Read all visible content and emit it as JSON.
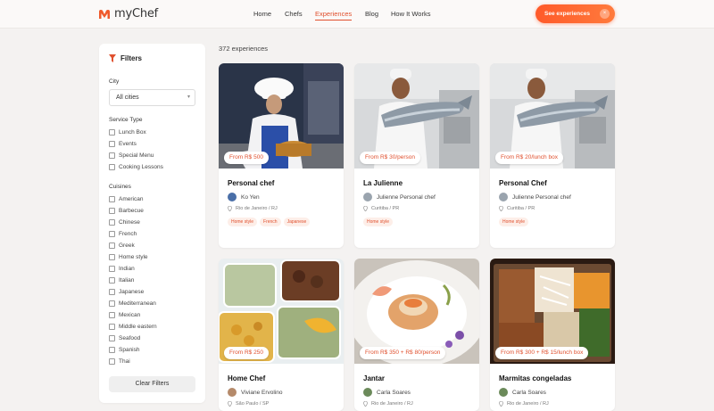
{
  "header": {
    "brand": "myChef",
    "nav": [
      {
        "label": "Home",
        "active": false
      },
      {
        "label": "Chefs",
        "active": false
      },
      {
        "label": "Experiences",
        "active": true
      },
      {
        "label": "Blog",
        "active": false
      },
      {
        "label": "How It Works",
        "active": false
      }
    ],
    "cta_label": "See experiences",
    "cta_close": "×",
    "accent": "#e0502e"
  },
  "sidebar": {
    "title": "Filters",
    "city_label": "City",
    "city_value": "All cities",
    "service_type_label": "Service Type",
    "service_types": [
      "Lunch Box",
      "Events",
      "Special Menu",
      "Cooking Lessons"
    ],
    "cuisines_label": "Cuisines",
    "cuisines": [
      "American",
      "Barbecue",
      "Chinese",
      "French",
      "Greek",
      "Home style",
      "Indian",
      "Italian",
      "Japanese",
      "Mediterranean",
      "Mexican",
      "Middle eastern",
      "Seafood",
      "Spanish",
      "Thai"
    ],
    "clear_label": "Clear Filters"
  },
  "main": {
    "count_text": "372 experiences",
    "cards": [
      {
        "title": "Personal chef",
        "price": "From R$ 500",
        "chef": "Ko Yen",
        "location": "Rio de Janeiro / RJ",
        "tags": [
          "Home style",
          "French",
          "Japanese"
        ],
        "image": "chef-cooking"
      },
      {
        "title": "La Julienne",
        "price": "From R$ 30/person",
        "chef": "Julienne Personal chef",
        "location": "Curitiba / PR",
        "tags": [
          "Home style"
        ],
        "image": "chef-fish"
      },
      {
        "title": "Personal Chef",
        "price": "From R$ 20/lunch box",
        "chef": "Julienne Personal chef",
        "location": "Curitiba / PR",
        "tags": [
          "Home style"
        ],
        "image": "chef-fish"
      },
      {
        "title": "Home Chef",
        "price": "From R$ 250",
        "chef": "Viviane Ervolino",
        "location": "São Paulo / SP",
        "tags": [],
        "image": "meal-boxes"
      },
      {
        "title": "Jantar",
        "price": "From R$ 350 + R$ 80/person",
        "chef": "Carla Soares",
        "location": "Rio de Janeiro / RJ",
        "tags": [],
        "image": "plated-dish"
      },
      {
        "title": "Marmitas congeladas",
        "price": "From R$ 300 + R$ 15/lunch box",
        "chef": "Carla Soares",
        "location": "Rio de Janeiro / RJ",
        "tags": [],
        "image": "pasta-tray"
      }
    ]
  }
}
